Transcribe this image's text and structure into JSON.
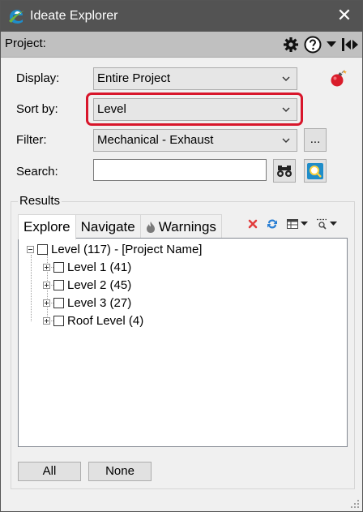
{
  "window": {
    "title": "Ideate Explorer",
    "close_glyph": "✕"
  },
  "project_bar": {
    "label": "Project:"
  },
  "form": {
    "display_label": "Display:",
    "display_value": "Entire Project",
    "sort_label": "Sort by:",
    "sort_value": "Level",
    "filter_label": "Filter:",
    "filter_value": "Mechanical - Exhaust",
    "filter_more_label": "...",
    "search_label": "Search:",
    "search_value": ""
  },
  "results": {
    "group_title": "Results",
    "tabs": [
      {
        "label": "Explore",
        "active": true
      },
      {
        "label": "Navigate",
        "active": false
      },
      {
        "label": "Warnings",
        "active": false
      }
    ],
    "tree": {
      "root": "Level (117) - [Project Name]",
      "children": [
        "Level 1 (41)",
        "Level 2 (45)",
        "Level 3 (27)",
        "Roof Level (4)"
      ]
    }
  },
  "footer": {
    "all_label": "All",
    "none_label": "None"
  },
  "colors": {
    "titlebar": "#535353",
    "project_bar": "#c0c0c0",
    "highlight": "#d8162b",
    "logo_blue": "#1f8dc9",
    "logo_green": "#6db33f",
    "delete_red": "#e23c3c",
    "refresh_blue": "#2a7fd4"
  }
}
